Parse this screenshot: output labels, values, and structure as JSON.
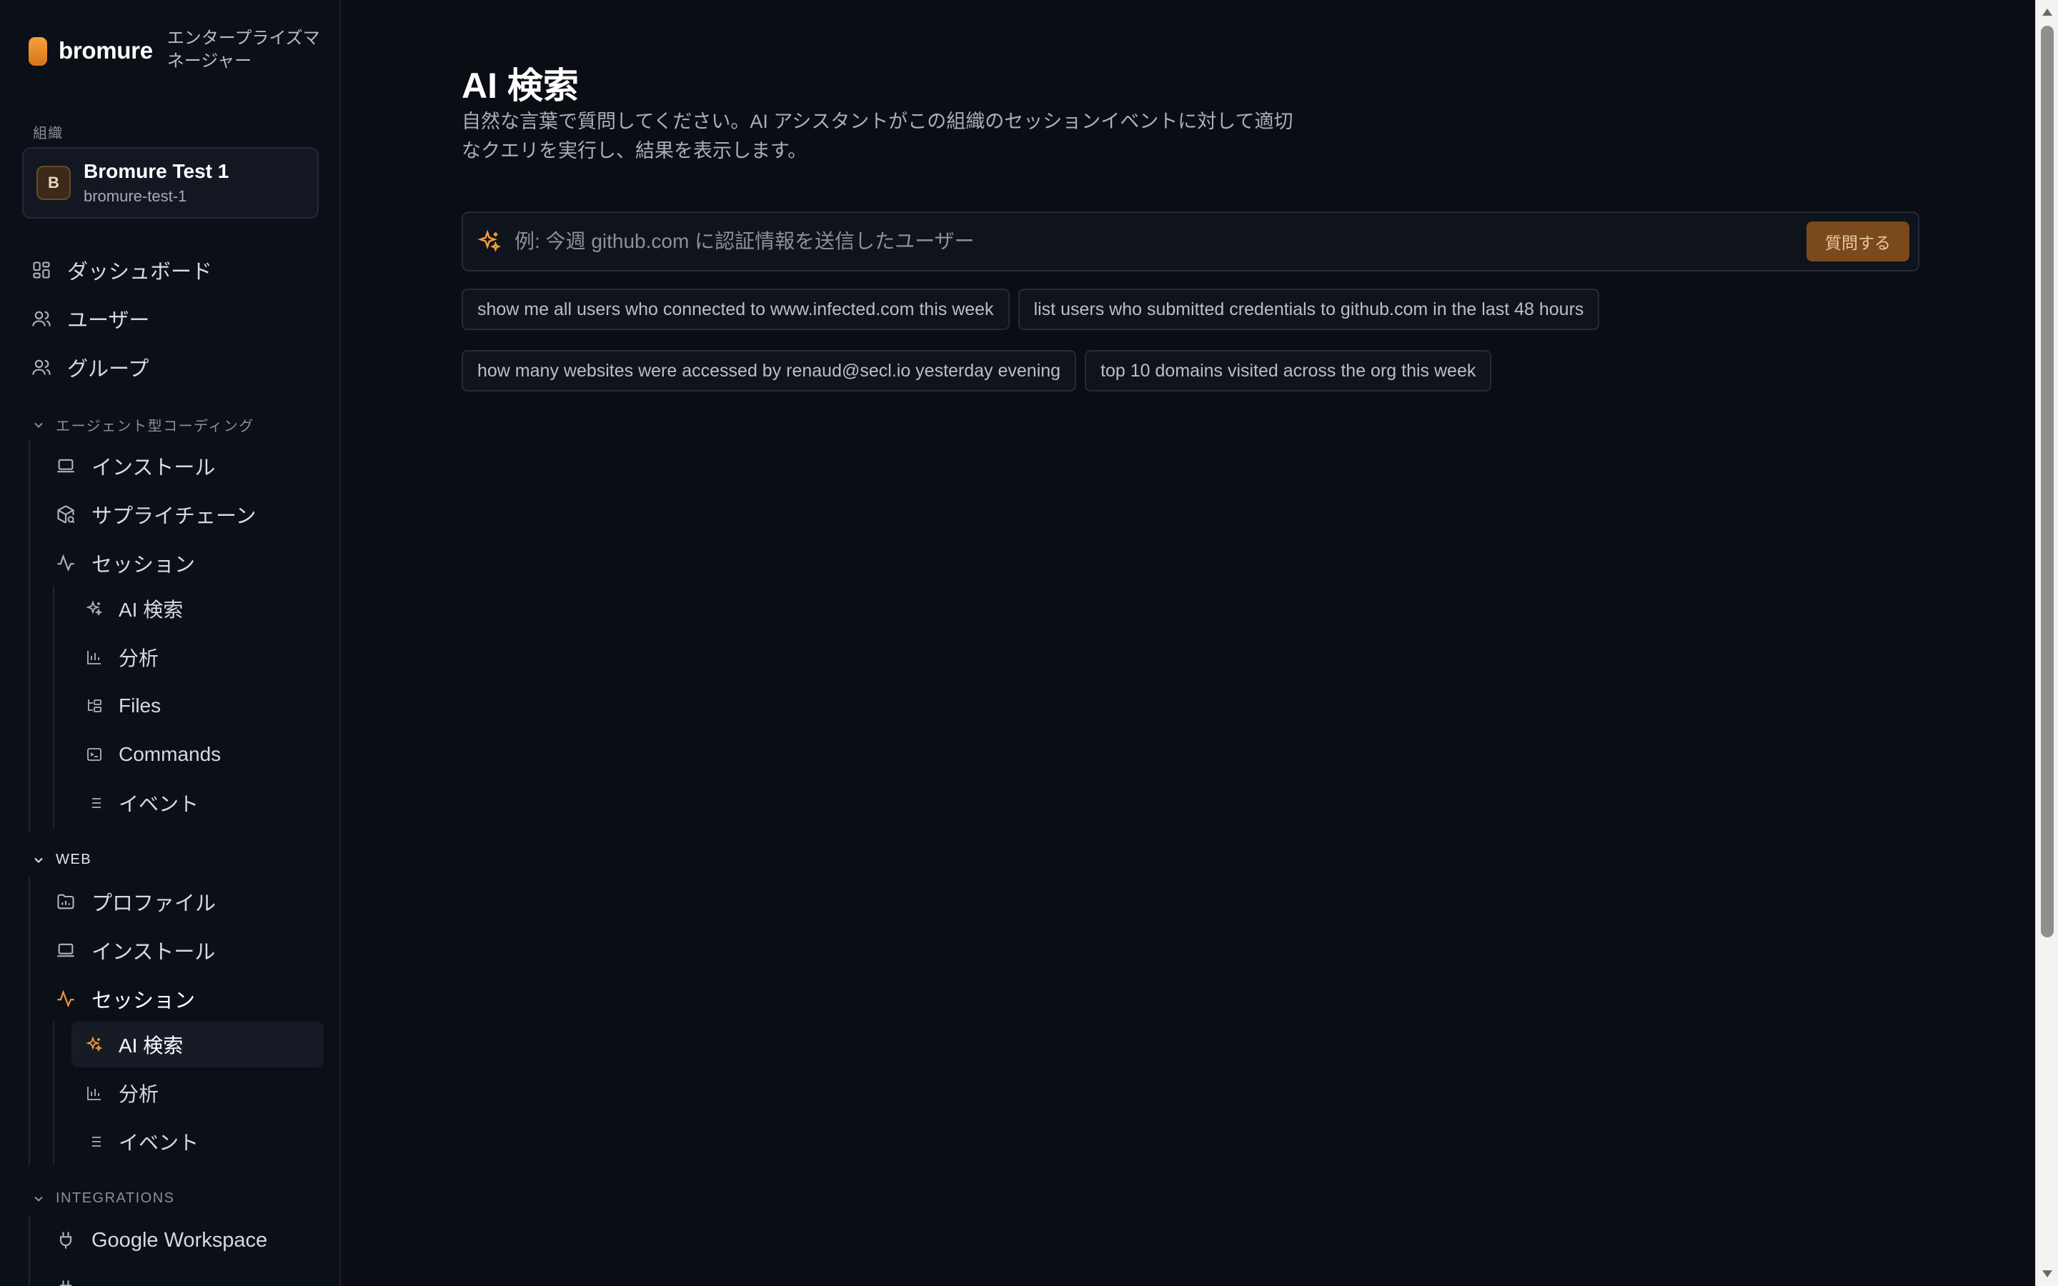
{
  "brand": {
    "name": "bromure",
    "subtitle": "エンタープライズマネージャー"
  },
  "org": {
    "section_label": "組織",
    "avatar_letter": "B",
    "name": "Bromure Test 1",
    "slug": "bromure-test-1"
  },
  "nav": {
    "dashboard": "ダッシュボード",
    "users": "ユーザー",
    "groups": "グループ"
  },
  "agentic": {
    "header": "エージェント型コーディング",
    "install": "インストール",
    "supply_chain": "サプライチェーン",
    "sessions": "セッション",
    "ai_search": "AI 検索",
    "analytics": "分析",
    "files": "Files",
    "commands": "Commands",
    "events": "イベント"
  },
  "web": {
    "header": "WEB",
    "profiles": "プロファイル",
    "install": "インストール",
    "sessions": "セッション",
    "ai_search": "AI 検索",
    "analytics": "分析",
    "events": "イベント"
  },
  "integrations": {
    "header": "INTEGRATIONS",
    "google": "Google Workspace"
  },
  "main": {
    "title": "AI 検索",
    "description": "自然な言葉で質問してください。AI アシスタントがこの組織のセッションイベントに対して適切なクエリを実行し、結果を表示します。",
    "search_placeholder": "例: 今週 github.com に認証情報を送信したユーザー",
    "ask_button": "質問する",
    "suggestions": [
      "show me all users who connected to www.infected.com this week",
      "list users who submitted credentials to github.com in the last 48 hours",
      "how many websites were accessed by renaud@secl.io yesterday evening",
      "top 10 domains visited across the org this week"
    ]
  },
  "colors": {
    "accent": "#f29a3a",
    "background": "#0a0d14",
    "sidebar": "#0b0f17",
    "button": "#7a4a1c"
  }
}
